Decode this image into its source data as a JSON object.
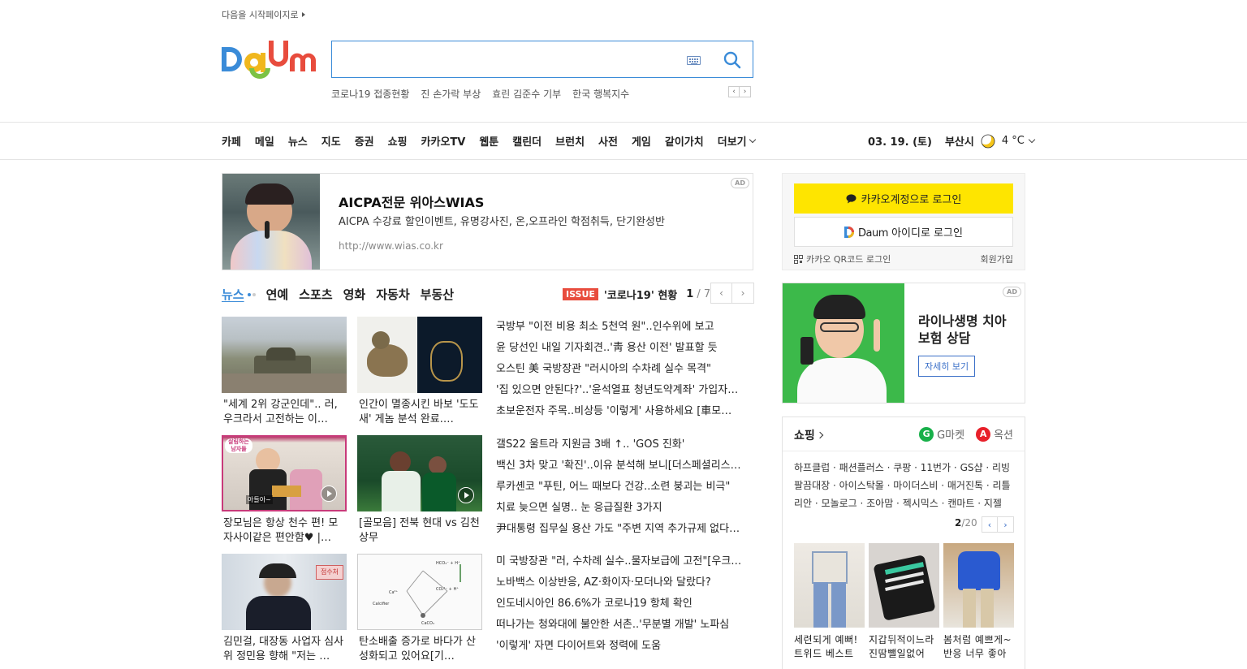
{
  "top": {
    "start_page": "다음을 시작페이지로"
  },
  "logo": {
    "alt": "Daum"
  },
  "search": {
    "value": "",
    "placeholder": ""
  },
  "trends": [
    "코로나19 접종현황",
    "진 손가락 부상",
    "효린 김준수 기부",
    "한국 행복지수"
  ],
  "gnb": {
    "items": [
      "카페",
      "메일",
      "뉴스",
      "지도",
      "증권",
      "쇼핑",
      "카카오TV",
      "웹툰",
      "캘린더",
      "브런치",
      "사전",
      "게임",
      "같이가치"
    ],
    "more": "더보기"
  },
  "weather": {
    "date": "03. 19. (토)",
    "city": "부산시",
    "temp": "4 °C",
    "icon": "moon-icon"
  },
  "ad1": {
    "badge": "AD",
    "title": "AICPA전문 위아스WIAS",
    "desc": "AICPA 수강료 할인이벤트, 유명강사진, 온,오프라인 학점취득, 단기완성반",
    "url": "http://www.wias.co.kr"
  },
  "news_tabs": [
    "뉴스",
    "연예",
    "스포츠",
    "영화",
    "자동차",
    "부동산"
  ],
  "issue": {
    "badge": "ISSUE",
    "title": "'코로나19' 현황",
    "page": "1",
    "total": "/ 7"
  },
  "cards": [
    {
      "caption": "\"세계 2위 강군인데\".. 러, 우크라서 고전하는 이…"
    },
    {
      "caption": "인간이 멸종시킨 바보 '도도새' 게놈 분석 완료.…"
    },
    {
      "caption": "장모님은 항상 천수 편! 모자사이같은 편안함♥ |…",
      "overlay": "살림하는 남자들",
      "overlay2": "아들아~"
    },
    {
      "caption": "[골모음] 전북 현대 vs 김천 상무"
    },
    {
      "caption": "김민걸, 대장동 사업자 심사위 정민용 향해 \"저는 …",
      "sign": "접수처"
    },
    {
      "caption": "탄소배출 증가로 바다가 산성화되고 있어요[기…",
      "labels": [
        "Ca²⁺",
        "Calcifier",
        "CaCO₃",
        "HCO₃⁻ + H⁺",
        "CO₃²⁻ + H⁺"
      ]
    }
  ],
  "headlines": [
    [
      "국방부 \"이전 비용 최소 5천억 원\"..인수위에 보고",
      "윤 당선인 내일 기자회견..'靑 용산 이전' 발표할 듯",
      "오스틴 美 국방장관 \"러시아의 수차례 실수 목격\"",
      "'집 있으면 안된다?'..'윤석열표 청년도약계좌' 가입자…",
      "초보운전자 주목..비상등 '이렇게' 사용하세요 [車모…"
    ],
    [
      "갤S22 울트라 지원금 3배 ↑.. 'GOS 진화'",
      "백신 3차 맞고 '확진'..이유 분석해 보니[더스페셜리스…",
      "루카셴코 \"푸틴, 어느 때보다 건강..소련 붕괴는 비극\"",
      "치료 늦으면 실명.. 눈 응급질환 3가지",
      "尹대통령 집무실 용산 가도 \"주변 지역 추가규제 없다…"
    ],
    [
      "미 국방장관 \"러, 수차례 실수..물자보급에 고전\"[우크…",
      "노바백스 이상반응, AZ·화이자·모더나와 달랐다?",
      "인도네시아인 86.6%가 코로나19 항체 확인",
      "떠나가는 청와대에 불안한 서촌..'무분별 개발' 노파심",
      "'이렇게' 자면 다이어트와 정력에 도움"
    ]
  ],
  "login": {
    "kakao": "카카오계정으로 로그인",
    "daum_brand": "Daum",
    "daum_rest": " 아이디로 로그인",
    "qr": "카카오 QR코드 로그인",
    "signup": "회원가입"
  },
  "ad2": {
    "badge": "AD",
    "title": "라이나생명 치아보험 상담",
    "button": "자세히 보기"
  },
  "shopping": {
    "title": "쇼핑",
    "gmarket": "G마켓",
    "auction": "옥션",
    "links": "하프클럽 · 패션플러스 · 쿠팡 · 11번가 · GS샵 · 리빙팔끔대장 · 아이스탁몰 · 마이더스비 · 매거진톡 · 리틀리안 · 모놀로그 · 조아맘 · 젝시믹스 · 캔마트 · 지젤",
    "page": "2",
    "total": "/20",
    "products": [
      "세련되게 예뻐! 트위드 베스트",
      "지갑뒤적이느라 진땀뺄일없어",
      "봄처럼 예쁘게~ 반응 너무 좋아"
    ]
  },
  "colors": {
    "accent": "#3a8bd8",
    "kakao": "#fee500",
    "issue": "#e84c3d",
    "ad2_bg": "#3cb94a"
  }
}
